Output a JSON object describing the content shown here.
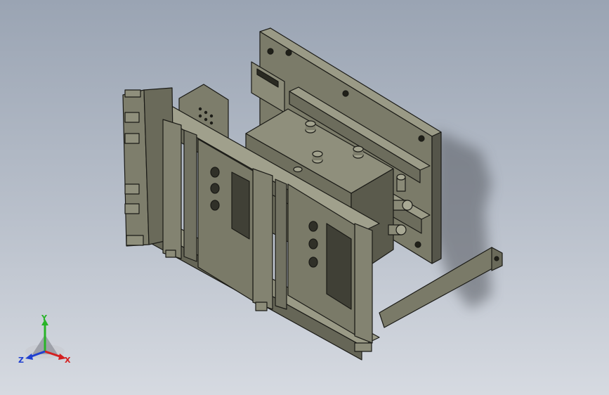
{
  "viewport": {
    "background_top": "#9aa4b3",
    "background_bottom": "#d6dae1",
    "part_color": "#7d7d6b",
    "edge_color": "#1a1a16"
  },
  "triad": {
    "x_label": "X",
    "y_label": "Y",
    "z_label": "Z",
    "x_color": "#d42020",
    "y_color": "#28b428",
    "z_color": "#2040d0"
  }
}
